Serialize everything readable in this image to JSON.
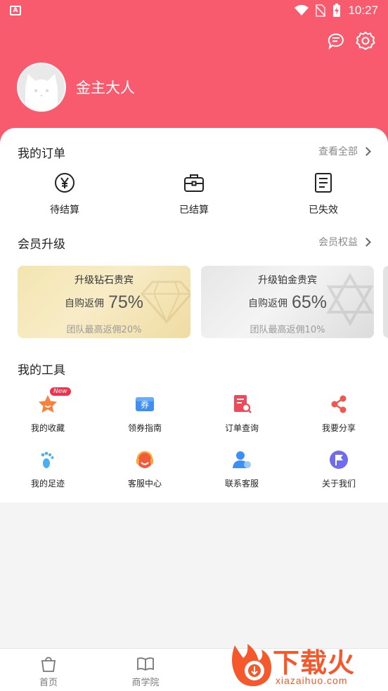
{
  "status_bar": {
    "time": "10:27"
  },
  "profile": {
    "name": "金主大人"
  },
  "orders": {
    "title": "我的订单",
    "view_all": "查看全部",
    "items": [
      {
        "label": "待结算",
        "icon": "yen-circle-icon"
      },
      {
        "label": "已结算",
        "icon": "briefcase-icon"
      },
      {
        "label": "已失效",
        "icon": "document-icon"
      }
    ]
  },
  "membership": {
    "title": "会员升级",
    "link": "会员权益",
    "tiers": [
      {
        "name": "升级钻石贵宾",
        "rate_label": "自购返佣",
        "rate": "75%",
        "team": "团队最高返佣20%",
        "color": "#f3e5b1"
      },
      {
        "name": "升级铂金贵宾",
        "rate_label": "自购返佣",
        "rate": "65%",
        "team": "团队最高返佣10%",
        "color": "#e6e6e6"
      }
    ]
  },
  "tools": {
    "title": "我的工具",
    "items": [
      {
        "label": "我的收藏",
        "icon": "star-icon",
        "badge": "New"
      },
      {
        "label": "领券指南",
        "icon": "coupon-icon",
        "glyph": "券"
      },
      {
        "label": "订单查询",
        "icon": "order-search-icon"
      },
      {
        "label": "我要分享",
        "icon": "share-icon"
      },
      {
        "label": "我的足迹",
        "icon": "footprint-icon"
      },
      {
        "label": "客服中心",
        "icon": "headset-icon"
      },
      {
        "label": "联系客服",
        "icon": "contact-icon"
      },
      {
        "label": "关于我们",
        "icon": "flag-icon"
      }
    ]
  },
  "tabbar": {
    "items": [
      {
        "label": "首页",
        "icon": "shopping-bag-icon"
      },
      {
        "label": "商学院",
        "icon": "book-icon"
      }
    ]
  },
  "watermark": {
    "text": "下载火",
    "url": "xiazaihuo.com"
  },
  "colors": {
    "brand": "#f95b6e",
    "accent": "#f4582b"
  }
}
